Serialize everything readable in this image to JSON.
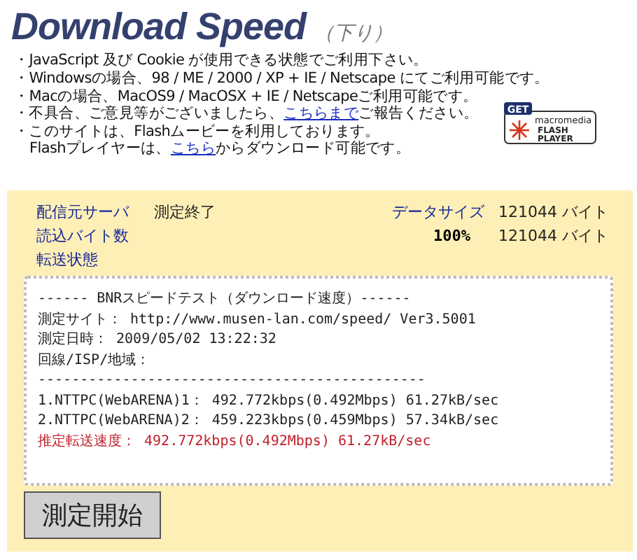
{
  "header": {
    "title": "Download Speed",
    "subtitle": "（下り）"
  },
  "notices": [
    {
      "kind": "bullet",
      "text": "・JavaScript 及び Cookie が使用できる状態でご利用下さい。"
    },
    {
      "kind": "bullet",
      "text": "・Windowsの場合、98 / ME / 2000 / XP + IE / Netscape にてご利用可能です。"
    },
    {
      "kind": "bullet",
      "text": "・Macの場合、MacOS9 / MacOSX + IE / Netscapeご利用可能です。"
    },
    {
      "kind": "bullet",
      "text": "・不具合、ご意見等がございましたら、",
      "link": "こちらまで",
      "after": "ご報告ください。"
    },
    {
      "kind": "bullet",
      "text": "・このサイトは、Flashムービーを利用しております。"
    },
    {
      "kind": "continuation",
      "text": "Flashプレイヤーは、",
      "link": "こちら",
      "after": "からダウンロード可能です。"
    }
  ],
  "flash_badge": {
    "get": "GET",
    "brand": "macromedia",
    "line1": "FLASH",
    "line2": "PLAYER"
  },
  "status": [
    {
      "label": "配信元サーバ",
      "value": "測定終了",
      "right_label": "データサイズ",
      "right_value": "121044 バイト"
    },
    {
      "label": "読込バイト数",
      "progress": "100%",
      "right_value": "121044 バイト"
    },
    {
      "label": "転送状態"
    }
  ],
  "result_lines": [
    {
      "kind": "normal",
      "text": "------ BNRスピードテスト（ダウンロード速度）------"
    },
    {
      "kind": "normal",
      "text": "測定サイト： http://www.musen-lan.com/speed/ Ver3.5001"
    },
    {
      "kind": "normal",
      "text": "測定日時： 2009/05/02 13:22:32"
    },
    {
      "kind": "normal",
      "text": "回線/ISP/地域："
    },
    {
      "kind": "normal",
      "text": "----------------------------------------------"
    },
    {
      "kind": "normal",
      "text": "1.NTTPC(WebARENA)1： 492.772kbps(0.492Mbps) 61.27kB/sec"
    },
    {
      "kind": "normal",
      "text": "2.NTTPC(WebARENA)2： 459.223kbps(0.459Mbps) 57.34kB/sec"
    },
    {
      "kind": "highlight",
      "text": "推定転送速度： 492.772kbps(0.492Mbps) 61.27kB/sec"
    }
  ],
  "start_button": "測定開始"
}
